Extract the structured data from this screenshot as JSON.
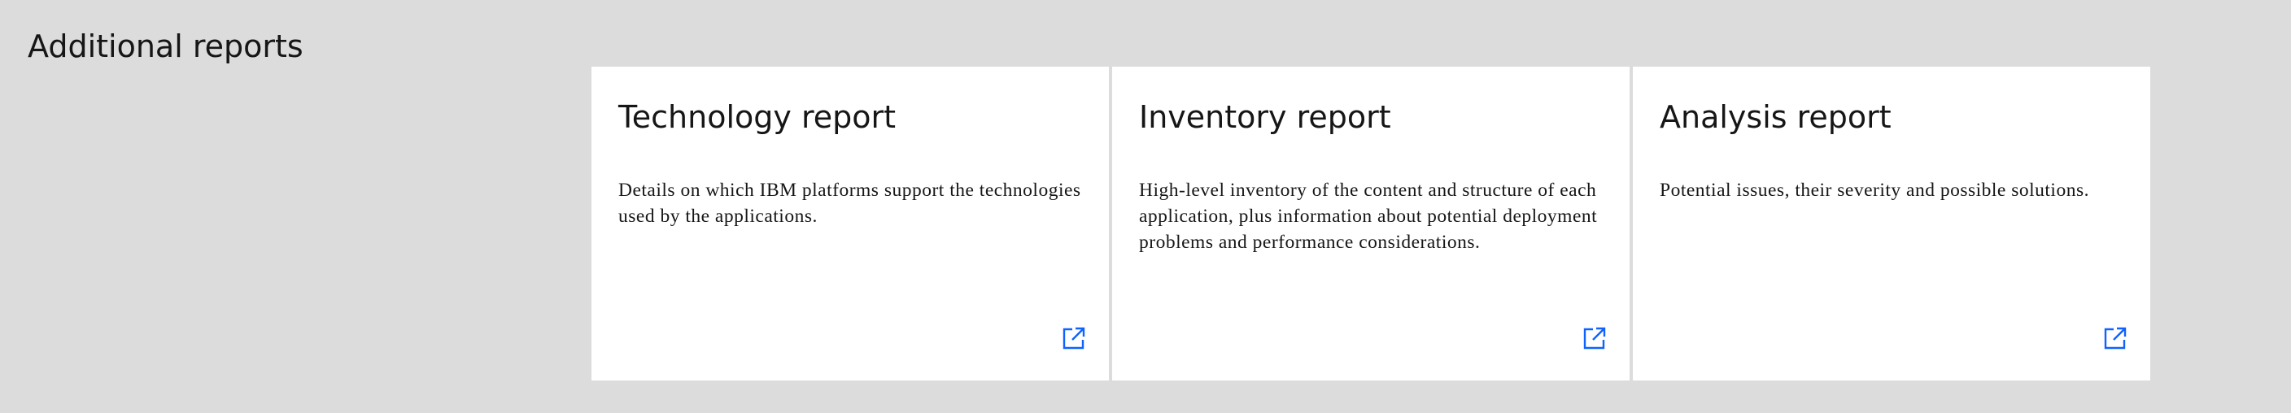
{
  "page": {
    "section_title": "Additional reports"
  },
  "colors": {
    "background": "#dcdcdc",
    "card_background": "#ffffff",
    "text": "#161616",
    "link_icon": "#0f62fe"
  },
  "cards": [
    {
      "title": "Technology report",
      "description": "Details on which IBM platforms support the technologies used by the applications.",
      "icon": "launch-icon"
    },
    {
      "title": "Inventory report",
      "description": "High-level inventory of the content and structure of each application, plus information about potential deployment problems and performance considerations.",
      "icon": "launch-icon"
    },
    {
      "title": "Analysis report",
      "description": "Potential issues, their severity and possible solutions.",
      "icon": "launch-icon"
    }
  ]
}
